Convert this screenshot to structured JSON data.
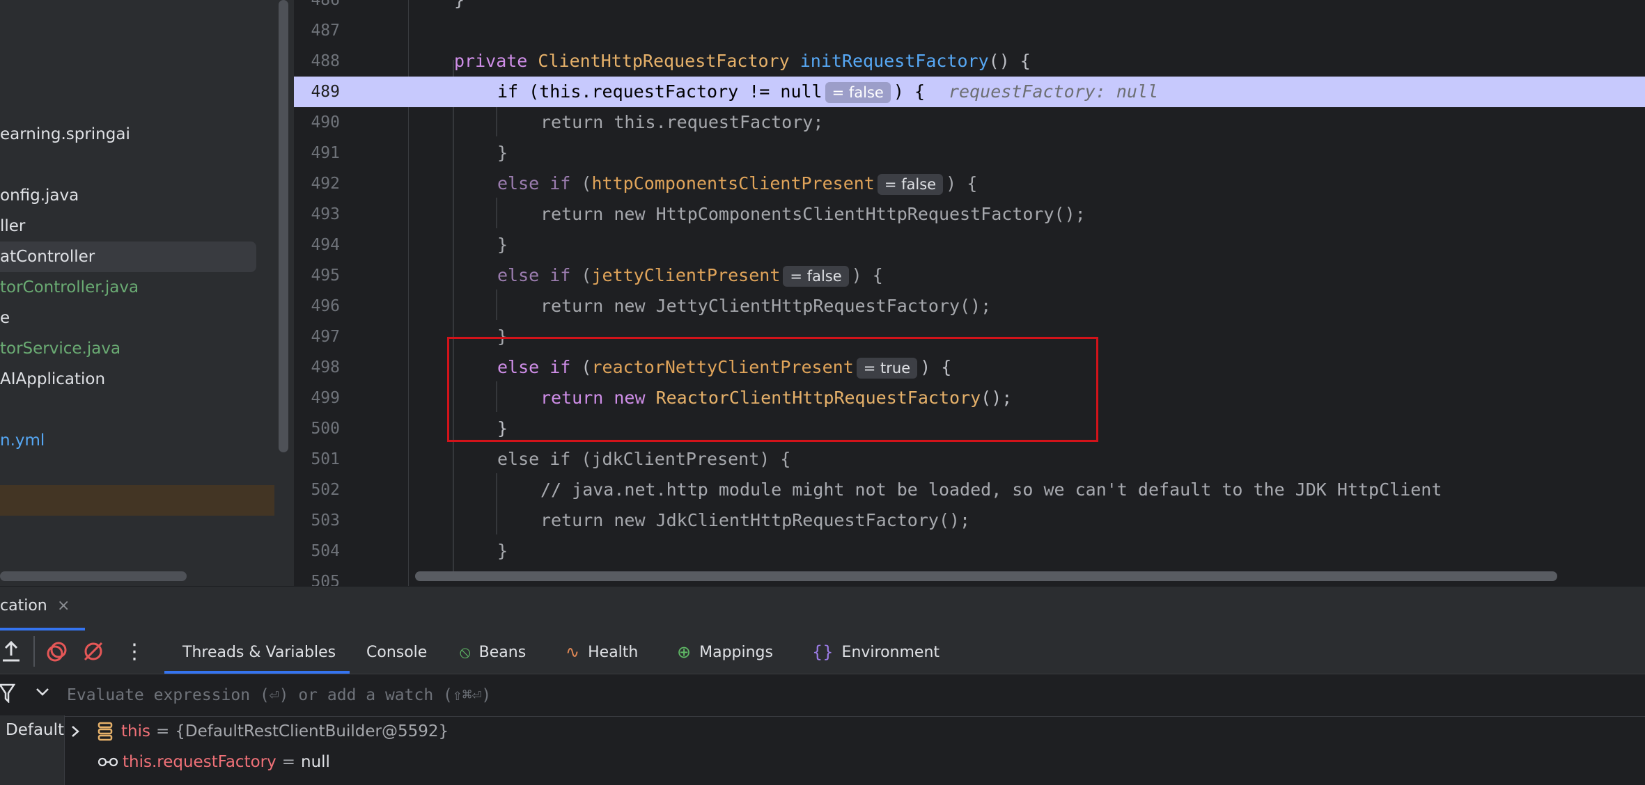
{
  "project_tree": [
    {
      "label": "earning.springai",
      "color": "#dfe1e5"
    },
    {
      "label": "onfig.java",
      "color": "#dfe1e5"
    },
    {
      "label": "ller",
      "color": "#dfe1e5"
    },
    {
      "label": "atController",
      "color": "#dfe1e5"
    },
    {
      "label": "torController.java",
      "color": "#6aab73"
    },
    {
      "label": "e",
      "color": "#dfe1e5"
    },
    {
      "label": "torService.java",
      "color": "#6aab73"
    },
    {
      "label": "AIApplication",
      "color": "#dfe1e5"
    },
    {
      "label": "n.yml",
      "color": "#56a8f5"
    }
  ],
  "editor": {
    "lines": [
      {
        "n": "486",
        "text": "}"
      },
      {
        "n": "487"
      },
      {
        "n": "488",
        "kw": "private",
        "type": "ClientHttpRequestFactory",
        "method": "initRequestFactory",
        "rest": "() {"
      },
      {
        "n": "489",
        "a": "if (this.",
        "field": "requestFactory",
        "b": " != null",
        "inline_value": "= false",
        "c": ") {",
        "hint": "requestFactory: null"
      },
      {
        "n": "490",
        "text": "return this.requestFactory;"
      },
      {
        "n": "491",
        "text": "}"
      },
      {
        "n": "492",
        "kw": "else if",
        "open": " (",
        "field": "httpComponentsClientPresent",
        "inline_value": "= false",
        "close": ") {"
      },
      {
        "n": "493",
        "text": "return new HttpComponentsClientHttpRequestFactory();"
      },
      {
        "n": "494",
        "text": "}"
      },
      {
        "n": "495",
        "kw": "else if",
        "open": " (",
        "field": "jettyClientPresent",
        "inline_value": "= false",
        "close": ") {"
      },
      {
        "n": "496",
        "text": "return new JettyClientHttpRequestFactory();"
      },
      {
        "n": "497",
        "text": "}"
      },
      {
        "n": "498",
        "kw": "else if",
        "open": " (",
        "field": "reactorNettyClientPresent",
        "inline_value": "= true",
        "close": ") {"
      },
      {
        "n": "499",
        "kw": "return new",
        "type": "ReactorClientHttpRequestFactory",
        "rest": "();"
      },
      {
        "n": "500",
        "text": "}"
      },
      {
        "n": "501",
        "text": "else if (jdkClientPresent) {"
      },
      {
        "n": "502",
        "text": "// java.net.http module might not be loaded, so we can't default to the JDK HttpClient"
      },
      {
        "n": "503",
        "text": "return new JdkClientHttpRequestFactory();"
      },
      {
        "n": "504",
        "text": "}"
      },
      {
        "n": "505"
      }
    ]
  },
  "debug": {
    "run_tab": "cation",
    "run_tab_close": "×",
    "toolbar_icons": [
      "export-icon",
      "mute-breakpoints-icon",
      "disable-breakpoints-icon",
      "more-icon"
    ],
    "tabs": [
      {
        "label": "Threads & Variables",
        "icon": "",
        "icon_color": ""
      },
      {
        "label": "Console",
        "icon": "",
        "icon_color": ""
      },
      {
        "label": "Beans",
        "icon": "⦸",
        "icon_color": "#5fb865"
      },
      {
        "label": "Health",
        "icon": "∿",
        "icon_color": "#e08855"
      },
      {
        "label": "Mappings",
        "icon": "⊕",
        "icon_color": "#5fb865"
      },
      {
        "label": "Environment",
        "icon": "{}",
        "icon_color": "#9c7ce8"
      }
    ],
    "eval_placeholder": "Evaluate expression (⏎) or add a watch (⇧⌘⏎)",
    "frame": "Default",
    "variables": [
      {
        "name": "this",
        "eq": "=",
        "value": "{DefaultRestClientBuilder@5592}"
      },
      {
        "name": "this.requestFactory",
        "eq": "=",
        "value": "null"
      }
    ]
  }
}
